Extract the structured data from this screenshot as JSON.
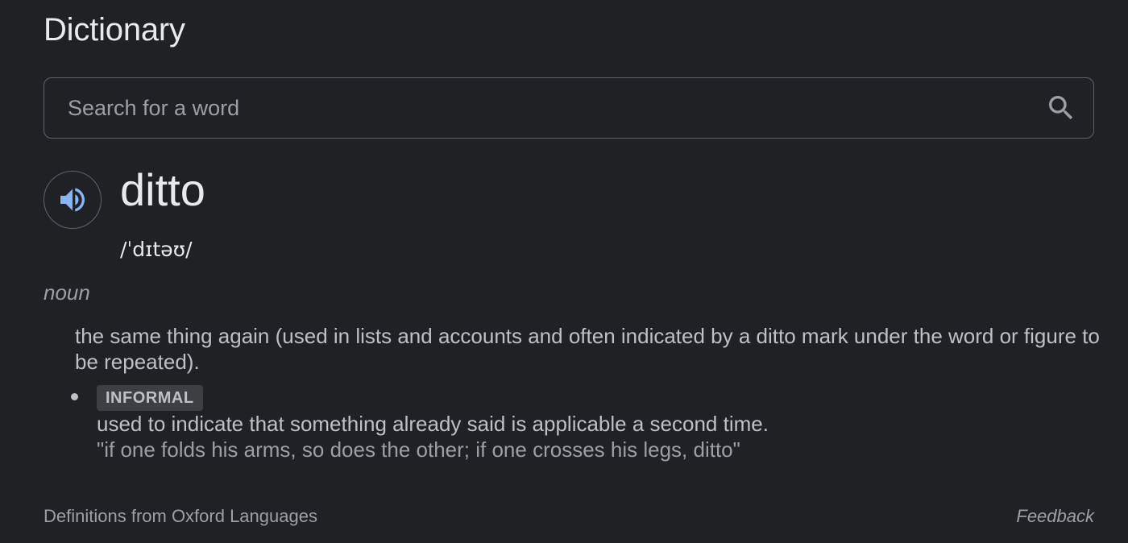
{
  "header": {
    "title": "Dictionary"
  },
  "search": {
    "placeholder": "Search for a word",
    "value": "",
    "icon": "search-icon"
  },
  "entry": {
    "word": "ditto",
    "phonetic": "/ˈdɪtəʊ/",
    "audio_icon": "speaker-icon",
    "part_of_speech": "noun",
    "definition": "the same thing again (used in lists and accounts and often indicated by a ditto mark under the word or figure to be repeated).",
    "senses": [
      {
        "label": "INFORMAL",
        "definition": "used to indicate that something already said is applicable a second time.",
        "example": "\"if one folds his arms, so does the other; if one crosses his legs, ditto\""
      }
    ]
  },
  "footer": {
    "source": "Definitions from Oxford Languages",
    "feedback": "Feedback"
  },
  "colors": {
    "background": "#202124",
    "primary_text": "#e8eaed",
    "secondary_text": "#bdc1c6",
    "muted_text": "#9aa0a6",
    "border": "#5f6368",
    "speaker_accent": "#8ab4f8"
  }
}
